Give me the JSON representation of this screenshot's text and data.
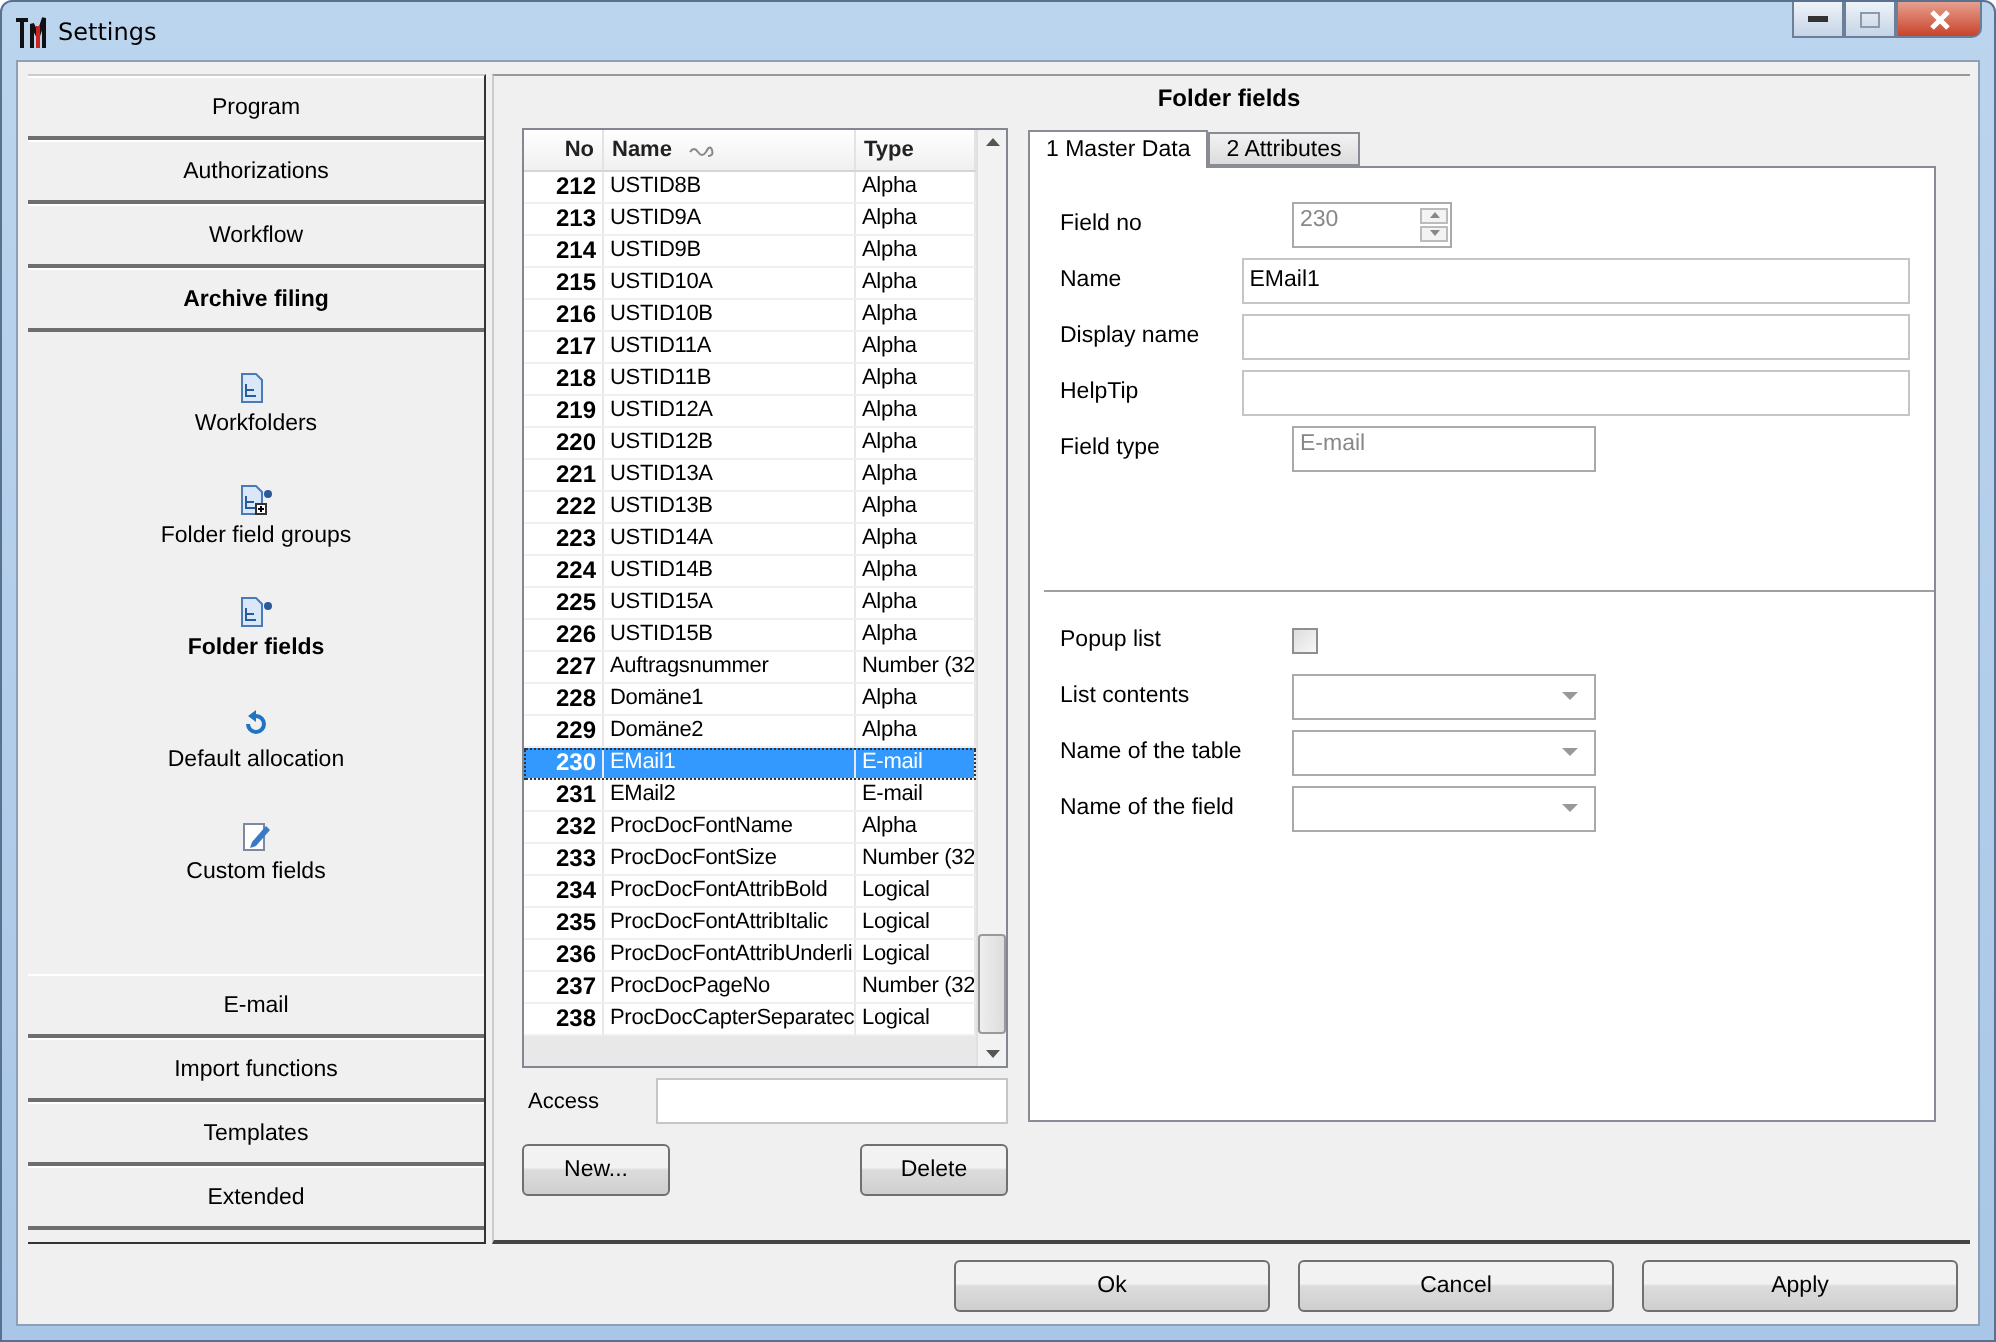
{
  "window": {
    "title": "Settings"
  },
  "sidebar": {
    "groups": [
      {
        "label": "Program",
        "selected": false
      },
      {
        "label": "Authorizations",
        "selected": false
      },
      {
        "label": "Workflow",
        "selected": false
      },
      {
        "label": "Archive filing",
        "selected": true
      }
    ],
    "items": [
      {
        "label": "Workfolders",
        "selected": false
      },
      {
        "label": "Folder field groups",
        "selected": false
      },
      {
        "label": "Folder fields",
        "selected": true
      },
      {
        "label": "Default allocation",
        "selected": false
      },
      {
        "label": "Custom fields",
        "selected": false
      }
    ],
    "bottom_groups": [
      {
        "label": "E-mail",
        "selected": false
      },
      {
        "label": "Import functions",
        "selected": false
      },
      {
        "label": "Templates",
        "selected": false
      },
      {
        "label": "Extended",
        "selected": false
      }
    ]
  },
  "panel": {
    "title": "Folder fields"
  },
  "table": {
    "columns": [
      "No",
      "Name",
      "Type"
    ],
    "rows": [
      {
        "no": "212",
        "name": "USTID8B",
        "type": "Alpha",
        "selected": false
      },
      {
        "no": "213",
        "name": "USTID9A",
        "type": "Alpha",
        "selected": false
      },
      {
        "no": "214",
        "name": "USTID9B",
        "type": "Alpha",
        "selected": false
      },
      {
        "no": "215",
        "name": "USTID10A",
        "type": "Alpha",
        "selected": false
      },
      {
        "no": "216",
        "name": "USTID10B",
        "type": "Alpha",
        "selected": false
      },
      {
        "no": "217",
        "name": "USTID11A",
        "type": "Alpha",
        "selected": false
      },
      {
        "no": "218",
        "name": "USTID11B",
        "type": "Alpha",
        "selected": false
      },
      {
        "no": "219",
        "name": "USTID12A",
        "type": "Alpha",
        "selected": false
      },
      {
        "no": "220",
        "name": "USTID12B",
        "type": "Alpha",
        "selected": false
      },
      {
        "no": "221",
        "name": "USTID13A",
        "type": "Alpha",
        "selected": false
      },
      {
        "no": "222",
        "name": "USTID13B",
        "type": "Alpha",
        "selected": false
      },
      {
        "no": "223",
        "name": "USTID14A",
        "type": "Alpha",
        "selected": false
      },
      {
        "no": "224",
        "name": "USTID14B",
        "type": "Alpha",
        "selected": false
      },
      {
        "no": "225",
        "name": "USTID15A",
        "type": "Alpha",
        "selected": false
      },
      {
        "no": "226",
        "name": "USTID15B",
        "type": "Alpha",
        "selected": false
      },
      {
        "no": "227",
        "name": "Auftragsnummer",
        "type": "Number (32",
        "selected": false
      },
      {
        "no": "228",
        "name": "Domäne1",
        "type": "Alpha",
        "selected": false
      },
      {
        "no": "229",
        "name": "Domäne2",
        "type": "Alpha",
        "selected": false
      },
      {
        "no": "230",
        "name": "EMail1",
        "type": "E-mail",
        "selected": true
      },
      {
        "no": "231",
        "name": "EMail2",
        "type": "E-mail",
        "selected": false
      },
      {
        "no": "232",
        "name": "ProcDocFontName",
        "type": "Alpha",
        "selected": false
      },
      {
        "no": "233",
        "name": "ProcDocFontSize",
        "type": "Number (32",
        "selected": false
      },
      {
        "no": "234",
        "name": "ProcDocFontAttribBold",
        "type": "Logical",
        "selected": false
      },
      {
        "no": "235",
        "name": "ProcDocFontAttribItalic",
        "type": "Logical",
        "selected": false
      },
      {
        "no": "236",
        "name": "ProcDocFontAttribUnderli",
        "type": "Logical",
        "selected": false
      },
      {
        "no": "237",
        "name": "ProcDocPageNo",
        "type": "Number (32",
        "selected": false
      },
      {
        "no": "238",
        "name": "ProcDocCapterSeparatec",
        "type": "Logical",
        "selected": false
      }
    ]
  },
  "access": {
    "label": "Access"
  },
  "list_buttons": [
    "New...",
    "Delete"
  ],
  "tabs": [
    {
      "label": "1 Master Data",
      "selected": true
    },
    {
      "label": "2 Attributes",
      "selected": false
    }
  ],
  "form": [
    {
      "kind": "spinner",
      "label": "Field no",
      "value": "230",
      "disabled": true
    },
    {
      "kind": "text",
      "label": "Name",
      "value": "EMail1",
      "disabled": false
    },
    {
      "kind": "text",
      "label": "Display name",
      "disabled": false
    },
    {
      "kind": "text",
      "label": "HelpTip",
      "disabled": false
    },
    {
      "kind": "short",
      "label": "Field type",
      "value": "E-mail",
      "disabled": true
    }
  ],
  "form2": [
    {
      "kind": "checkbox",
      "label": "Popup list",
      "checked": false
    },
    {
      "kind": "dropdown",
      "label": "List contents"
    },
    {
      "kind": "dropdown",
      "label": "Name of the table"
    },
    {
      "kind": "dropdown",
      "label": "Name of the field"
    }
  ],
  "buttons": [
    "Ok",
    "Cancel",
    "Apply"
  ]
}
